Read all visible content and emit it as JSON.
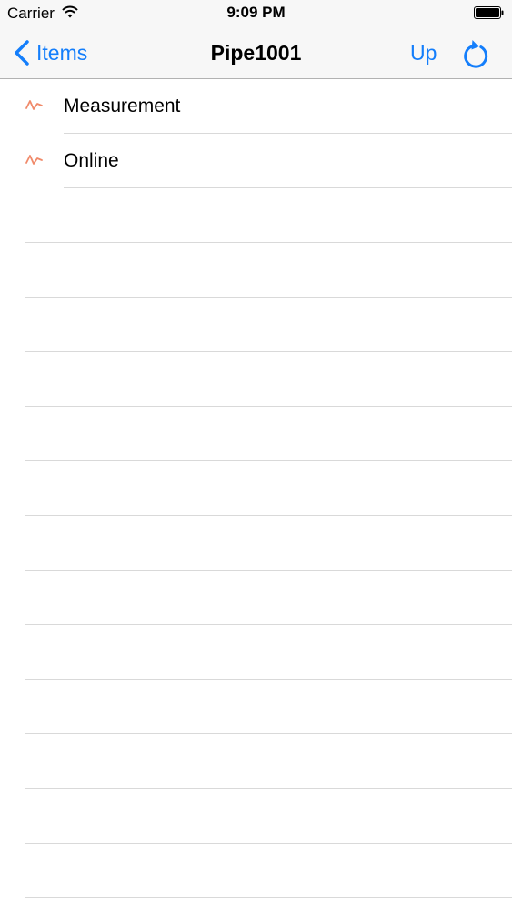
{
  "status_bar": {
    "carrier": "Carrier",
    "time": "9:09 PM"
  },
  "nav": {
    "back_label": "Items",
    "title": "Pipe1001",
    "up_label": "Up",
    "refresh_icon": "refresh-icon"
  },
  "rows": [
    {
      "label": "Measurement",
      "icon": "trend-line-icon"
    },
    {
      "label": "Online",
      "icon": "trend-line-icon"
    }
  ],
  "colors": {
    "accent": "#147efb",
    "icon": "#f08a6a",
    "separator": "#d9d9d9",
    "bar_background": "#f7f7f7"
  }
}
